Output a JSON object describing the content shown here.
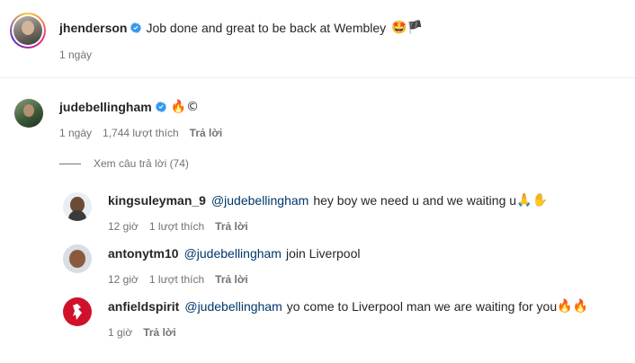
{
  "post": {
    "author": "jhenderson",
    "caption": "Job done and great to be back at Wembley",
    "emojis": "🤩🏴",
    "time": "1 ngày"
  },
  "comment": {
    "author": "judebellingham",
    "text": "🔥©",
    "time": "1 ngày",
    "likes": "1,744 lượt thích",
    "reply_label": "Trả lời",
    "view_replies": "Xem câu trả lời (74)"
  },
  "replies": [
    {
      "author": "kingsuleyman_9",
      "mention": "@judebellingham",
      "text": "hey boy we need u and we waiting u",
      "emojis": "🙏✋",
      "time": "12 giờ",
      "likes": "1 lượt thích",
      "reply_label": "Trả lời"
    },
    {
      "author": "antonytm10",
      "mention": "@judebellingham",
      "text": "join Liverpool",
      "emojis": "",
      "time": "12 giờ",
      "likes": "1 lượt thích",
      "reply_label": "Trả lời"
    },
    {
      "author": "anfieldspirit",
      "mention": "@judebellingham",
      "text": "yo come to Liverpool man we are waiting for you",
      "emojis": "🔥🔥",
      "time": "1 giờ",
      "likes": "",
      "reply_label": "Trả lời"
    }
  ],
  "colors": {
    "verified": "#3897f0",
    "mention": "#00376b",
    "meta": "#737373",
    "story_ring": "#e1306c"
  },
  "icons": [
    "verified-badge-icon",
    "avatar"
  ]
}
